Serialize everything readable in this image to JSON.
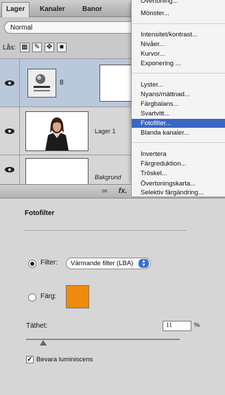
{
  "layers_panel": {
    "tabs": [
      "Lager",
      "Kanaler",
      "Banor"
    ],
    "blend_mode": "Normal",
    "lock_label": "Lås:",
    "layers": [
      {
        "name": "",
        "type": "adjustment",
        "visible": true
      },
      {
        "name": "Lager 1",
        "type": "photo",
        "visible": true
      },
      {
        "name": "Bakgrund",
        "type": "background",
        "visible": true
      }
    ],
    "bottom_icons": [
      "link-icon",
      "fx-icon",
      "mask-icon",
      "adjustment-icon",
      "folder-icon",
      "new-layer-icon",
      "trash-icon"
    ],
    "fx_label": "fx."
  },
  "menu": {
    "items": [
      "Övertoning...",
      "Mönster...",
      "Intensitet/kontrast...",
      "Nivåer...",
      "Kurvor...",
      "Exponering ...",
      "Lyster...",
      "Nyans/mättnad...",
      "Färgbalans...",
      "Svartvitt...",
      "Fotofilter...",
      "Blanda kanaler...",
      "Invertera",
      "Färgreduktion...",
      "Tröskel...",
      "Övertoningskarta...",
      "Selektiv färgändring..."
    ],
    "highlighted": "Fotofilter..."
  },
  "photo_filter": {
    "title": "Fotofilter",
    "filter_label": "Filter:",
    "filter_value": "Värmande filter (LBA)",
    "color_label": "Färg:",
    "color": "#f08a0c",
    "density_label": "Täthet:",
    "density_value": "11",
    "density_unit": "%",
    "density_level": 0.11,
    "preserve_label": "Bevara luminiscens",
    "preserve_checked": true,
    "selected_mode": "filter"
  },
  "colors": {
    "menu_highlight": "#3a66c4",
    "selected_layer": "#bac8dc",
    "swatch": "#f08a0c"
  }
}
